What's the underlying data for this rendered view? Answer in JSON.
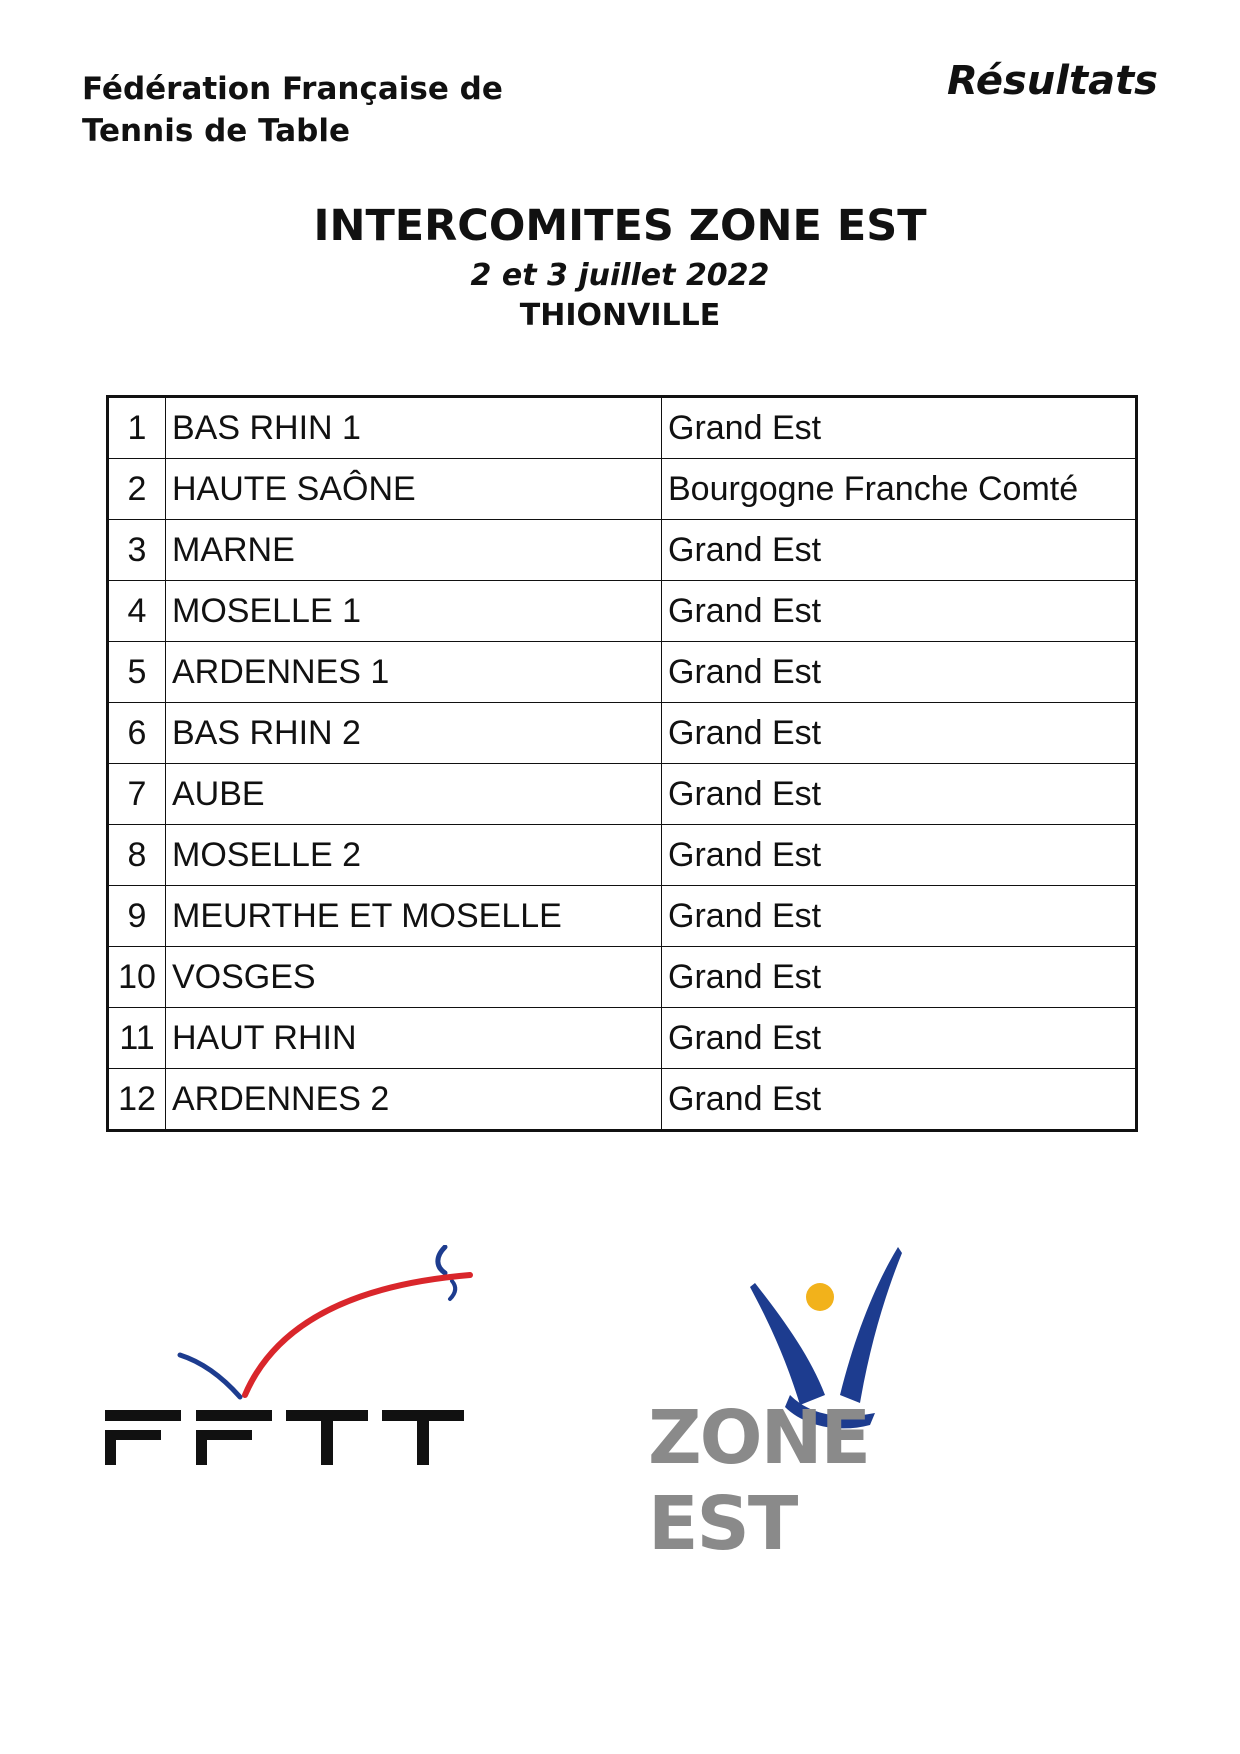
{
  "header": {
    "org_line1": "Fédération Française de",
    "org_line2": "Tennis de Table",
    "label": "Résultats"
  },
  "event": {
    "title": "INTERCOMITES ZONE EST",
    "date": "2 et 3 juillet 2022",
    "city": "THIONVILLE"
  },
  "results": [
    {
      "rank": "1",
      "team": "BAS RHIN 1",
      "region": "Grand Est"
    },
    {
      "rank": "2",
      "team": "HAUTE SAÔNE",
      "region": "Bourgogne Franche Comté"
    },
    {
      "rank": "3",
      "team": "MARNE",
      "region": "Grand Est"
    },
    {
      "rank": "4",
      "team": "MOSELLE 1",
      "region": "Grand Est"
    },
    {
      "rank": "5",
      "team": "ARDENNES 1",
      "region": "Grand Est"
    },
    {
      "rank": "6",
      "team": "BAS RHIN 2",
      "region": "Grand Est"
    },
    {
      "rank": "7",
      "team": "AUBE",
      "region": "Grand Est"
    },
    {
      "rank": "8",
      "team": "MOSELLE 2",
      "region": "Grand Est"
    },
    {
      "rank": "9",
      "team": "MEURTHE ET MOSELLE",
      "region": "Grand Est"
    },
    {
      "rank": "10",
      "team": "VOSGES",
      "region": "Grand Est"
    },
    {
      "rank": "11",
      "team": "HAUT RHIN",
      "region": "Grand Est"
    },
    {
      "rank": "12",
      "team": "ARDENNES 2",
      "region": "Grand Est"
    }
  ],
  "logos": {
    "fftt_text": "FFTT",
    "zone_text": "ZONE EST",
    "colors": {
      "blue": "#1d3c8f",
      "red": "#d9262b",
      "yellow": "#f2b21b",
      "grey": "#8a8a8a"
    }
  }
}
